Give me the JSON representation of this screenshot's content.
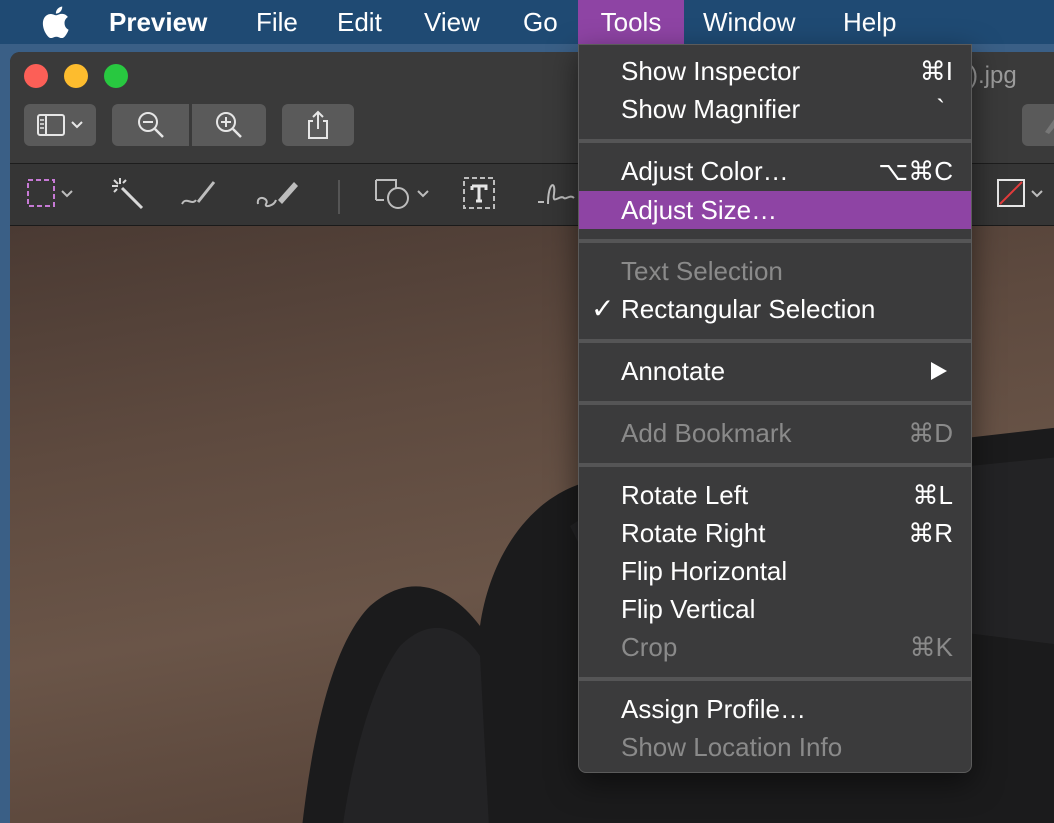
{
  "menubar": {
    "app": "Preview",
    "items": [
      "File",
      "Edit",
      "View",
      "Go",
      "Tools",
      "Window",
      "Help"
    ],
    "active": "Tools"
  },
  "window": {
    "title_fragment": ").jpg"
  },
  "tools_menu": {
    "show_inspector": {
      "label": "Show Inspector",
      "shortcut": "⌘I"
    },
    "show_magnifier": {
      "label": "Show Magnifier",
      "shortcut": "`"
    },
    "adjust_color": {
      "label": "Adjust Color…",
      "shortcut": "⌥⌘C"
    },
    "adjust_size": {
      "label": "Adjust Size…",
      "shortcut": ""
    },
    "text_selection": {
      "label": "Text Selection",
      "shortcut": ""
    },
    "rect_selection": {
      "label": "Rectangular Selection",
      "check": "✓"
    },
    "annotate": {
      "label": "Annotate"
    },
    "add_bookmark": {
      "label": "Add Bookmark",
      "shortcut": "⌘D"
    },
    "rotate_left": {
      "label": "Rotate Left",
      "shortcut": "⌘L"
    },
    "rotate_right": {
      "label": "Rotate Right",
      "shortcut": "⌘R"
    },
    "flip_horizontal": {
      "label": "Flip Horizontal",
      "shortcut": ""
    },
    "flip_vertical": {
      "label": "Flip Vertical",
      "shortcut": ""
    },
    "crop": {
      "label": "Crop",
      "shortcut": "⌘K"
    },
    "assign_profile": {
      "label": "Assign Profile…",
      "shortcut": ""
    },
    "show_location": {
      "label": "Show Location Info",
      "shortcut": ""
    }
  },
  "colors": {
    "menubar_bg": "#1f4a73",
    "highlight": "#8e44a4",
    "menu_bg": "#3b3b3c"
  }
}
